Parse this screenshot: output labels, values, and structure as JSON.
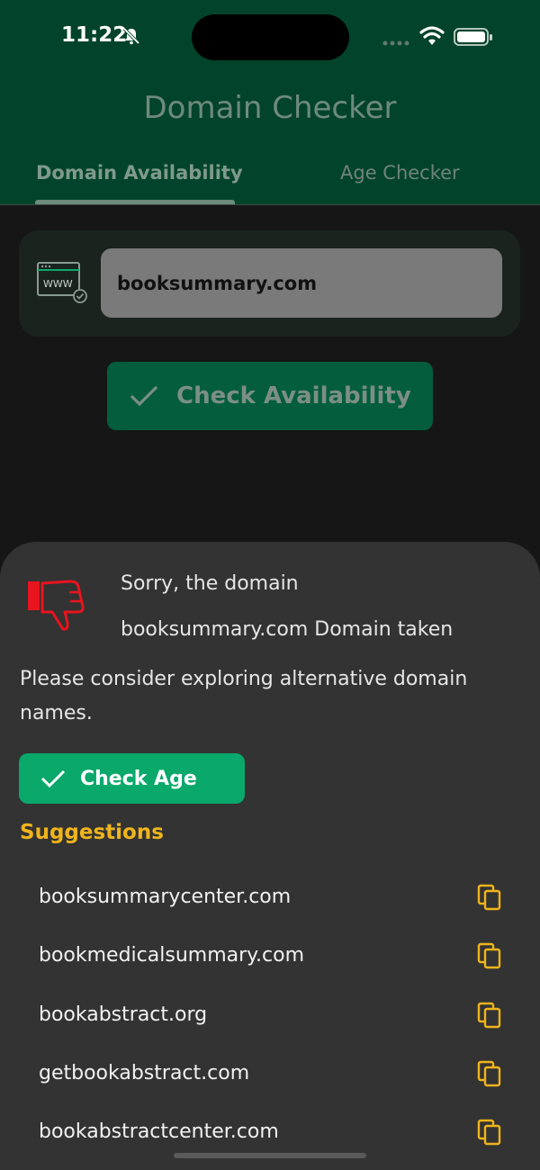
{
  "status_bar": {
    "time": "11:22"
  },
  "header": {
    "title": "Domain Checker",
    "tabs": [
      {
        "label": "Domain Availability",
        "active": true
      },
      {
        "label": "Age Checker",
        "active": false
      }
    ]
  },
  "form": {
    "domain_value": "booksummary.com",
    "check_label": "Check Availability"
  },
  "result": {
    "line1": "Sorry, the domain",
    "line2": "booksummary.com Domain taken",
    "message": "Please consider exploring alternative domain names.",
    "age_button_label": "Check Age",
    "suggestions_title": "Suggestions",
    "suggestions": [
      "booksummarycenter.com",
      "bookmedicalsummary.com",
      "bookabstract.org",
      "getbookabstract.com",
      "bookabstractcenter.com"
    ]
  },
  "colors": {
    "header_bg": "#02442b",
    "accent_green": "#0aa86b",
    "suggestion_accent": "#f0b41c",
    "error_red": "#e8141e"
  }
}
